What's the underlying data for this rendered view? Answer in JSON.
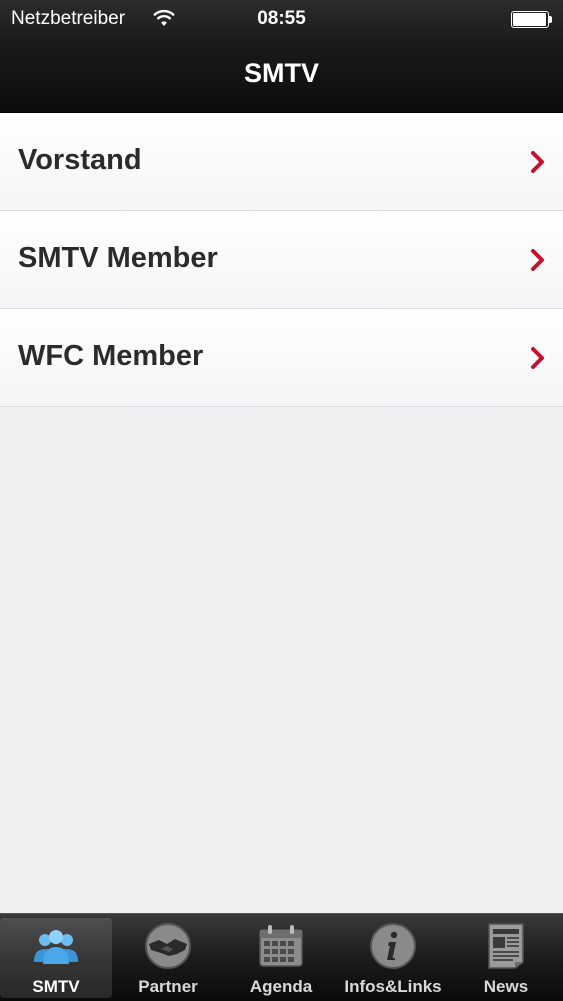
{
  "status_bar": {
    "carrier": "Netzbetreiber",
    "time": "08:55"
  },
  "nav": {
    "title": "SMTV"
  },
  "list": {
    "items": [
      {
        "label": "Vorstand"
      },
      {
        "label": "SMTV Member"
      },
      {
        "label": "WFC Member"
      }
    ]
  },
  "colors": {
    "chevron": "#c8102e",
    "nav_bg": "#1a1a1a",
    "active_tab_icon": "#4aa8e8"
  },
  "tab_bar": {
    "tabs": [
      {
        "label": "SMTV",
        "icon": "members-icon",
        "active": true
      },
      {
        "label": "Partner",
        "icon": "handshake-icon",
        "active": false
      },
      {
        "label": "Agenda",
        "icon": "calendar-icon",
        "active": false
      },
      {
        "label": "Infos&Links",
        "icon": "info-icon",
        "active": false
      },
      {
        "label": "News",
        "icon": "newspaper-icon",
        "active": false
      }
    ]
  }
}
